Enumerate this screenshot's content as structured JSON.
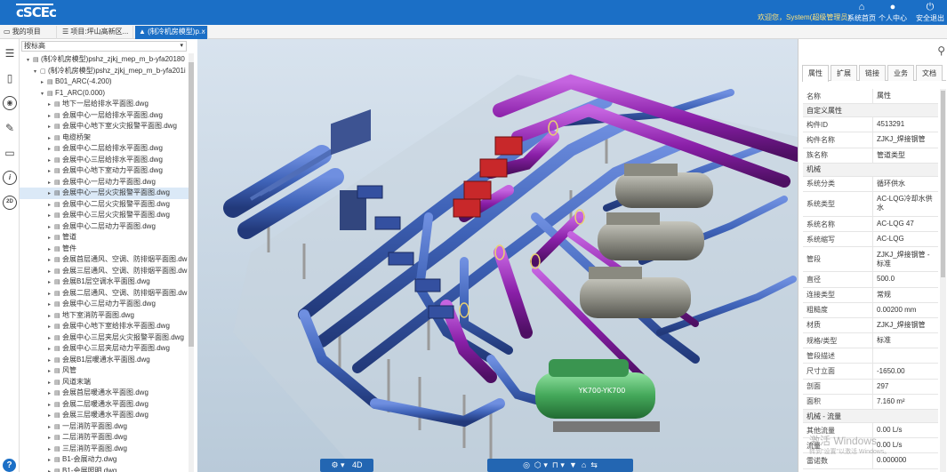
{
  "header": {
    "logo_text": "cSCEc",
    "welcome": "欢迎您，System(超级管理员)",
    "nav": [
      {
        "icon": "home-icon",
        "label": "系统首页"
      },
      {
        "icon": "user-icon",
        "label": "个人中心"
      },
      {
        "icon": "power-icon",
        "label": "安全退出"
      }
    ]
  },
  "tabs": [
    {
      "label": "我的项目"
    },
    {
      "label": "项目:坪山高新区..."
    },
    {
      "label": "(制冷机房模型)p...",
      "close": "×"
    }
  ],
  "tree": {
    "sort_label": "按标高",
    "sort_arrow": "▾",
    "items": [
      {
        "indent": 0,
        "toggle": "▾",
        "icon": "▤",
        "label": "(制冷机房模型)pshz_zjkj_mep_m_b-yfa20180"
      },
      {
        "indent": 1,
        "toggle": "▾",
        "icon": "▢",
        "label": "(制冷机房模型)pshz_zjkj_mep_m_b-yfa201i"
      },
      {
        "indent": 2,
        "toggle": "▸",
        "icon": "▤",
        "label": "B01_ARC(-4.200)"
      },
      {
        "indent": 2,
        "toggle": "▾",
        "icon": "▤",
        "label": "F1_ARC(0.000)"
      },
      {
        "indent": 3,
        "toggle": "▸",
        "icon": "▤",
        "label": "地下一层给排水平面图.dwg"
      },
      {
        "indent": 3,
        "toggle": "▸",
        "icon": "▤",
        "label": "会展中心一层给排水平面图.dwg"
      },
      {
        "indent": 3,
        "toggle": "▸",
        "icon": "▤",
        "label": "会展中心地下室火灾报警平面图.dwg"
      },
      {
        "indent": 3,
        "toggle": "▸",
        "icon": "▤",
        "label": "电缆桥架"
      },
      {
        "indent": 3,
        "toggle": "▸",
        "icon": "▤",
        "label": "会展中心二层给排水平面图.dwg"
      },
      {
        "indent": 3,
        "toggle": "▸",
        "icon": "▤",
        "label": "会展中心三层给排水平面图.dwg"
      },
      {
        "indent": 3,
        "toggle": "▸",
        "icon": "▤",
        "label": "会展中心地下室动力平面图.dwg"
      },
      {
        "indent": 3,
        "toggle": "▸",
        "icon": "▤",
        "label": "会展中心一层动力平面图.dwg"
      },
      {
        "indent": 3,
        "toggle": "▸",
        "icon": "▤",
        "label": "会展中心一层火灾报警平面图.dwg",
        "selected": true
      },
      {
        "indent": 3,
        "toggle": "▸",
        "icon": "▤",
        "label": "会展中心二层火灾报警平面图.dwg"
      },
      {
        "indent": 3,
        "toggle": "▸",
        "icon": "▤",
        "label": "会展中心三层火灾报警平面图.dwg"
      },
      {
        "indent": 3,
        "toggle": "▸",
        "icon": "▤",
        "label": "会展中心二层动力平面图.dwg"
      },
      {
        "indent": 3,
        "toggle": "▸",
        "icon": "▤",
        "label": "管道"
      },
      {
        "indent": 3,
        "toggle": "▸",
        "icon": "▤",
        "label": "管件"
      },
      {
        "indent": 3,
        "toggle": "▸",
        "icon": "▤",
        "label": "会展首层通风、空调、防排烟平面图.dw"
      },
      {
        "indent": 3,
        "toggle": "▸",
        "icon": "▤",
        "label": "会展三层通风、空调、防排烟平面图.dw"
      },
      {
        "indent": 3,
        "toggle": "▸",
        "icon": "▤",
        "label": "会展B1层空调水平面图.dwg"
      },
      {
        "indent": 3,
        "toggle": "▸",
        "icon": "▤",
        "label": "会展二层通风、空调、防排烟平面图.dw"
      },
      {
        "indent": 3,
        "toggle": "▸",
        "icon": "▤",
        "label": "会展中心三层动力平面图.dwg"
      },
      {
        "indent": 3,
        "toggle": "▸",
        "icon": "▤",
        "label": "地下室消防平面图.dwg"
      },
      {
        "indent": 3,
        "toggle": "▸",
        "icon": "▤",
        "label": "会展中心地下室给排水平面图.dwg"
      },
      {
        "indent": 3,
        "toggle": "▸",
        "icon": "▤",
        "label": "会展中心三层夹层火灾报警平面图.dwg"
      },
      {
        "indent": 3,
        "toggle": "▸",
        "icon": "▤",
        "label": "会展中心三层夹层动力平面图.dwg"
      },
      {
        "indent": 3,
        "toggle": "▸",
        "icon": "▤",
        "label": "会展B1层暖通水平面图.dwg"
      },
      {
        "indent": 3,
        "toggle": "▸",
        "icon": "▤",
        "label": "风管"
      },
      {
        "indent": 3,
        "toggle": "▸",
        "icon": "▤",
        "label": "风道末端"
      },
      {
        "indent": 3,
        "toggle": "▸",
        "icon": "▤",
        "label": "会展首层暖通水平面图.dwg"
      },
      {
        "indent": 3,
        "toggle": "▸",
        "icon": "▤",
        "label": "会展二层暖通水平面图.dwg"
      },
      {
        "indent": 3,
        "toggle": "▸",
        "icon": "▤",
        "label": "会展三层暖通水平面图.dwg"
      },
      {
        "indent": 3,
        "toggle": "▸",
        "icon": "▤",
        "label": "一层消防平面图.dwg"
      },
      {
        "indent": 3,
        "toggle": "▸",
        "icon": "▤",
        "label": "二层消防平面图.dwg"
      },
      {
        "indent": 3,
        "toggle": "▸",
        "icon": "▤",
        "label": "三层消防平面图.dwg"
      },
      {
        "indent": 3,
        "toggle": "▸",
        "icon": "▤",
        "label": "B1-会展动力.dwg"
      },
      {
        "indent": 3,
        "toggle": "▸",
        "icon": "▤",
        "label": "B1-会展照明.dwg"
      }
    ]
  },
  "left_tools": [
    {
      "icon": "layers-icon",
      "glyph": "☰"
    },
    {
      "icon": "building-icon",
      "glyph": "▯"
    },
    {
      "icon": "eye-icon",
      "glyph": "◉"
    },
    {
      "icon": "edit-icon",
      "glyph": "✎"
    },
    {
      "icon": "folder-icon",
      "glyph": "▭"
    },
    {
      "icon": "info-icon",
      "glyph": "i"
    },
    {
      "icon": "2d-icon",
      "glyph": "2D"
    }
  ],
  "help_glyph": "?",
  "viewport": {
    "equipment_label": "YK700-YK700",
    "toolbar_left": [
      {
        "name": "settings-button",
        "label": "⚙ ▾"
      },
      {
        "name": "4d-button",
        "label": "4D"
      }
    ],
    "toolbar_right": [
      {
        "name": "measure-button",
        "label": "◎"
      },
      {
        "name": "section-button",
        "label": "⬡ ▾"
      },
      {
        "name": "walk-button",
        "label": "⊓ ▾"
      },
      {
        "name": "filter-button",
        "label": "▼"
      },
      {
        "name": "home-view-button",
        "label": "⌂"
      },
      {
        "name": "explode-button",
        "label": "⇆"
      }
    ]
  },
  "properties": {
    "tabs": [
      {
        "label": "属性",
        "active": true
      },
      {
        "label": "扩展"
      },
      {
        "label": "链接"
      },
      {
        "label": "业务"
      },
      {
        "label": "文档"
      }
    ],
    "rows": [
      {
        "k": "名称",
        "v": "属性",
        "header": true
      },
      {
        "k": "自定义属性",
        "section": true
      },
      {
        "k": "构件ID",
        "v": "4513291"
      },
      {
        "k": "构件名称",
        "v": "ZJKJ_焊接钢管"
      },
      {
        "k": "族名称",
        "v": "管道类型"
      },
      {
        "k": "机械",
        "section": true
      },
      {
        "k": "系统分类",
        "v": "循环供水"
      },
      {
        "k": "系统类型",
        "v": "AC-LQG冷却水供水",
        "tall": true
      },
      {
        "k": "系统名称",
        "v": "AC-LQG 47"
      },
      {
        "k": "系统缩写",
        "v": "AC-LQG"
      },
      {
        "k": "管段",
        "v": "ZJKJ_焊接钢管 - 标准",
        "tall": true
      },
      {
        "k": "直径",
        "v": "500.0"
      },
      {
        "k": "连接类型",
        "v": "常规"
      },
      {
        "k": "粗糙度",
        "v": "0.00200 mm"
      },
      {
        "k": "材质",
        "v": "ZJKJ_焊接钢管"
      },
      {
        "k": "规格/类型",
        "v": "标准"
      },
      {
        "k": "管段描述",
        "v": ""
      },
      {
        "k": "尺寸立面",
        "v": "-1650.00"
      },
      {
        "k": "剖面",
        "v": "297"
      },
      {
        "k": "面积",
        "v": "7.160 m²"
      },
      {
        "k": "机械 - 流量",
        "section": true
      },
      {
        "k": "其他流量",
        "v": "0.00 L/s"
      },
      {
        "k": "流量",
        "v": "0.00 L/s"
      },
      {
        "k": "雷诺数",
        "v": "0.000000"
      }
    ]
  },
  "watermark": {
    "line1": "激活 Windows",
    "line2": "转到\"设置\"以激活 Windows。"
  },
  "colors": {
    "header_blue": "#1b6fc6",
    "pipe_blue": "#3f63b8",
    "pipe_purple": "#8a1fa8",
    "chiller_gray": "#8f8f86",
    "chiller_green": "#44a85a",
    "pump_red": "#c8282a"
  }
}
